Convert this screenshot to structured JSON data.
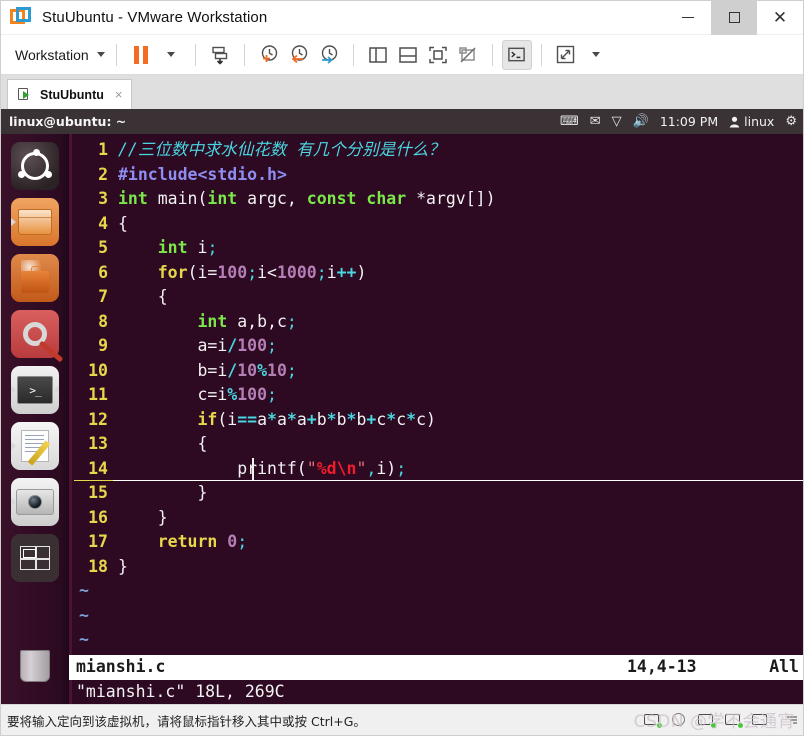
{
  "window": {
    "title": "StuUbuntu - VMware Workstation",
    "logo_icon": "vmware-logo-icon",
    "buttons": {
      "minimize": "minimize-icon",
      "maximize": "maximize-icon",
      "close": "close-icon"
    }
  },
  "toolbar": {
    "menu_label": "Workstation",
    "items": [
      {
        "name": "pause-vm-button",
        "icon": "pause-icon"
      },
      {
        "name": "power-dropdown-button",
        "icon": "chevron-down-icon"
      },
      {
        "name": "manage-vm-button",
        "icon": "vm-send-icon"
      },
      {
        "name": "take-snapshot-button",
        "icon": "snapshot-add-icon"
      },
      {
        "name": "revert-snapshot-button",
        "icon": "snapshot-revert-icon"
      },
      {
        "name": "snapshot-manager-button",
        "icon": "snapshot-manager-icon"
      },
      {
        "name": "show-sidebar-button",
        "icon": "panel-left-icon"
      },
      {
        "name": "show-console-view-button",
        "icon": "panel-bottom-icon"
      },
      {
        "name": "show-thumbnails-button",
        "icon": "fit-screen-icon"
      },
      {
        "name": "disable-preview-button",
        "icon": "no-preview-icon"
      },
      {
        "name": "console-toggle-button",
        "icon": "terminal-icon"
      },
      {
        "name": "fullscreen-button",
        "icon": "expand-arrows-icon"
      },
      {
        "name": "fullscreen-dropdown-button",
        "icon": "chevron-down-icon"
      }
    ]
  },
  "tabs": [
    {
      "label": "StuUbuntu",
      "icon": "vm-running-icon",
      "close": "×"
    }
  ],
  "ubuntu_panel": {
    "title": "linux@ubuntu: ~",
    "indicators": [
      {
        "name": "keyboard-indicator",
        "glyph": "⌨"
      },
      {
        "name": "mail-indicator",
        "glyph": "✉"
      },
      {
        "name": "network-indicator",
        "glyph": "▽"
      },
      {
        "name": "volume-indicator",
        "glyph": "🔊"
      }
    ],
    "clock": "11:09 PM",
    "user": "linux",
    "power_icon": "power-gear-icon"
  },
  "launcher": {
    "items": [
      {
        "name": "launcher-dash",
        "label": "Dash home",
        "icon": "ubuntu-logo-icon"
      },
      {
        "name": "launcher-files",
        "label": "Files",
        "icon": "folder-icon"
      },
      {
        "name": "launcher-software-center",
        "label": "Ubuntu Software Center",
        "icon": "shopping-bag-icon"
      },
      {
        "name": "launcher-system-settings",
        "label": "System Settings",
        "icon": "gear-wrench-icon"
      },
      {
        "name": "launcher-terminal",
        "label": "Terminal",
        "icon": "terminal-icon"
      },
      {
        "name": "launcher-text-editor",
        "label": "Text Editor",
        "icon": "document-pencil-icon"
      },
      {
        "name": "launcher-screenshot",
        "label": "Screenshot",
        "icon": "camera-icon"
      },
      {
        "name": "launcher-workspace-switcher",
        "label": "Workspace Switcher",
        "icon": "workspace-grid-icon"
      },
      {
        "name": "launcher-trash",
        "label": "Trash",
        "icon": "trash-icon"
      }
    ]
  },
  "editor": {
    "lines": [
      {
        "n": "1",
        "tokens": [
          {
            "t": "//三位数中求水仙花数 有几个分别是什么？",
            "c": "c-comment"
          }
        ]
      },
      {
        "n": "2",
        "tokens": [
          {
            "t": "#include<stdio.h>",
            "c": "c-pre"
          }
        ]
      },
      {
        "n": "3",
        "tokens": [
          {
            "t": "int",
            "c": "c-type"
          },
          {
            "t": " main(",
            "c": "c-plain"
          },
          {
            "t": "int",
            "c": "c-type"
          },
          {
            "t": " argc, ",
            "c": "c-plain"
          },
          {
            "t": "const",
            "c": "c-type"
          },
          {
            "t": " ",
            "c": "c-plain"
          },
          {
            "t": "char",
            "c": "c-type"
          },
          {
            "t": " *argv[])",
            "c": "c-plain"
          }
        ]
      },
      {
        "n": "4",
        "tokens": [
          {
            "t": "{",
            "c": "c-plain"
          }
        ]
      },
      {
        "n": "5",
        "tokens": [
          {
            "t": "    ",
            "c": "c-plain"
          },
          {
            "t": "int",
            "c": "c-type"
          },
          {
            "t": " i",
            "c": "c-plain"
          },
          {
            "t": ";",
            "c": "c-punct"
          }
        ]
      },
      {
        "n": "6",
        "tokens": [
          {
            "t": "    ",
            "c": "c-plain"
          },
          {
            "t": "for",
            "c": "c-kw"
          },
          {
            "t": "(i=",
            "c": "c-plain"
          },
          {
            "t": "100",
            "c": "c-num"
          },
          {
            "t": ";",
            "c": "c-punct"
          },
          {
            "t": "i<",
            "c": "c-plain"
          },
          {
            "t": "1000",
            "c": "c-num"
          },
          {
            "t": ";",
            "c": "c-punct"
          },
          {
            "t": "i",
            "c": "c-plain"
          },
          {
            "t": "++",
            "c": "c-op"
          },
          {
            "t": ")",
            "c": "c-plain"
          }
        ]
      },
      {
        "n": "7",
        "tokens": [
          {
            "t": "    {",
            "c": "c-plain"
          }
        ]
      },
      {
        "n": "8",
        "tokens": [
          {
            "t": "        ",
            "c": "c-plain"
          },
          {
            "t": "int",
            "c": "c-type"
          },
          {
            "t": " a,b,c",
            "c": "c-plain"
          },
          {
            "t": ";",
            "c": "c-punct"
          }
        ]
      },
      {
        "n": "9",
        "tokens": [
          {
            "t": "        a=i",
            "c": "c-plain"
          },
          {
            "t": "/",
            "c": "c-op"
          },
          {
            "t": "100",
            "c": "c-num"
          },
          {
            "t": ";",
            "c": "c-punct"
          }
        ]
      },
      {
        "n": "10",
        "tokens": [
          {
            "t": "        b=i",
            "c": "c-plain"
          },
          {
            "t": "/",
            "c": "c-op"
          },
          {
            "t": "10",
            "c": "c-num"
          },
          {
            "t": "%",
            "c": "c-op"
          },
          {
            "t": "10",
            "c": "c-num"
          },
          {
            "t": ";",
            "c": "c-punct"
          }
        ]
      },
      {
        "n": "11",
        "tokens": [
          {
            "t": "        c=i",
            "c": "c-plain"
          },
          {
            "t": "%",
            "c": "c-op"
          },
          {
            "t": "100",
            "c": "c-num"
          },
          {
            "t": ";",
            "c": "c-punct"
          }
        ]
      },
      {
        "n": "12",
        "tokens": [
          {
            "t": "        ",
            "c": "c-plain"
          },
          {
            "t": "if",
            "c": "c-kw"
          },
          {
            "t": "(i",
            "c": "c-plain"
          },
          {
            "t": "==",
            "c": "c-op"
          },
          {
            "t": "a",
            "c": "c-plain"
          },
          {
            "t": "*",
            "c": "c-op"
          },
          {
            "t": "a",
            "c": "c-plain"
          },
          {
            "t": "*",
            "c": "c-op"
          },
          {
            "t": "a",
            "c": "c-plain"
          },
          {
            "t": "+",
            "c": "c-op"
          },
          {
            "t": "b",
            "c": "c-plain"
          },
          {
            "t": "*",
            "c": "c-op"
          },
          {
            "t": "b",
            "c": "c-plain"
          },
          {
            "t": "*",
            "c": "c-op"
          },
          {
            "t": "b",
            "c": "c-plain"
          },
          {
            "t": "+",
            "c": "c-op"
          },
          {
            "t": "c",
            "c": "c-plain"
          },
          {
            "t": "*",
            "c": "c-op"
          },
          {
            "t": "c",
            "c": "c-plain"
          },
          {
            "t": "*",
            "c": "c-op"
          },
          {
            "t": "c)",
            "c": "c-plain"
          }
        ]
      },
      {
        "n": "13",
        "tokens": [
          {
            "t": "        {",
            "c": "c-plain"
          }
        ]
      },
      {
        "n": "14",
        "cursor": true,
        "tokens": [
          {
            "t": "            printf(",
            "c": "c-plain"
          },
          {
            "t": "\"",
            "c": "c-str"
          },
          {
            "t": "%d",
            "c": "c-esc"
          },
          {
            "t": "\\n",
            "c": "c-esc"
          },
          {
            "t": "\"",
            "c": "c-str"
          },
          {
            "t": ",",
            "c": "c-punct"
          },
          {
            "t": "i)",
            "c": "c-plain"
          },
          {
            "t": ";",
            "c": "c-punct"
          }
        ]
      },
      {
        "n": "15",
        "tokens": [
          {
            "t": "        }",
            "c": "c-plain"
          }
        ]
      },
      {
        "n": "16",
        "tokens": [
          {
            "t": "    }",
            "c": "c-plain"
          }
        ]
      },
      {
        "n": "17",
        "tokens": [
          {
            "t": "    ",
            "c": "c-plain"
          },
          {
            "t": "return",
            "c": "c-kw"
          },
          {
            "t": " ",
            "c": "c-plain"
          },
          {
            "t": "0",
            "c": "c-num"
          },
          {
            "t": ";",
            "c": "c-punct"
          }
        ]
      },
      {
        "n": "18",
        "tokens": [
          {
            "t": "}",
            "c": "c-plain"
          }
        ]
      }
    ],
    "empty_markers": [
      "~",
      "~",
      "~",
      "~"
    ],
    "status": {
      "filename": "mianshi.c",
      "position": "14,4-13",
      "scroll": "All"
    },
    "message": "\"mianshi.c\" 18L, 269C"
  },
  "statusbar": {
    "message": "要将输入定向到该虚拟机，请将鼠标指针移入其中或按 Ctrl+G。",
    "devices": [
      {
        "name": "status-hard-disk-icon",
        "icon": "hard-disk-icon"
      },
      {
        "name": "status-cd-dvd-icon",
        "icon": "cd-dvd-icon"
      },
      {
        "name": "status-network-icon",
        "icon": "network-icon"
      },
      {
        "name": "status-usb-icon",
        "icon": "usb-icon"
      },
      {
        "name": "status-printer-icon",
        "icon": "printer-icon"
      }
    ],
    "watermark": "CSDN @学不会通宵",
    "resize_grip": "resize-grip-icon"
  },
  "colors": {
    "accent_orange": "#f26c21",
    "accent_blue": "#2e9ad0",
    "terminal_bg": "#2d0922",
    "panel_bg": "#3b3235",
    "vim_linenum": "#e7d84b"
  }
}
